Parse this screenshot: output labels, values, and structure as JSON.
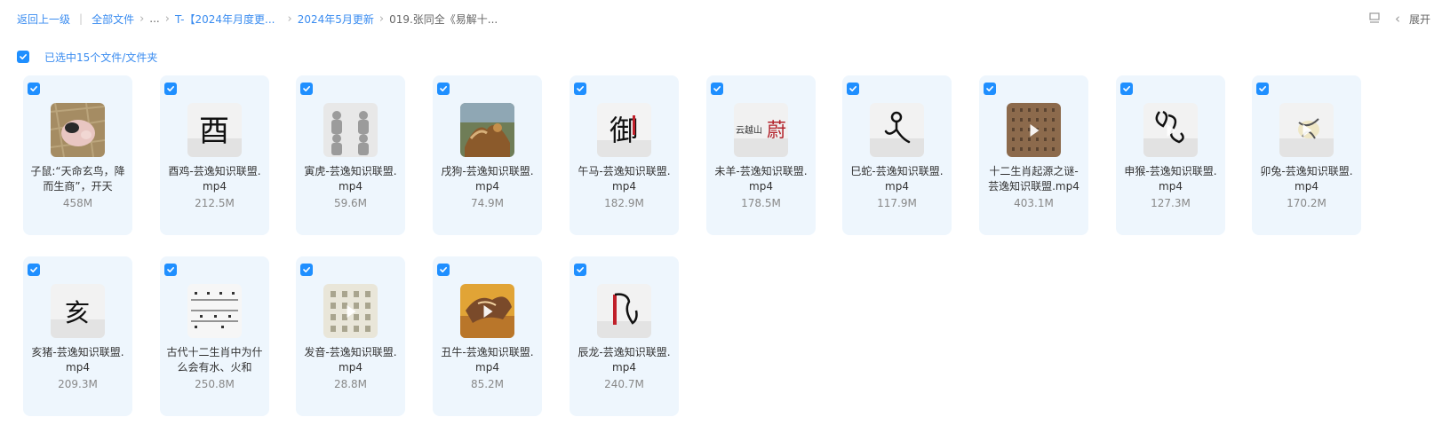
{
  "breadcrumb": {
    "back": "返回上一级",
    "all_files": "全部文件",
    "ellipsis": "...",
    "folder1": "T-【2024年月度更...",
    "folder2": "2024年5月更新",
    "current": "019.张同全《易解十..."
  },
  "top_right": {
    "expand_label": "展开"
  },
  "selection": {
    "label": "已选中15个文件/文件夹"
  },
  "files": [
    {
      "name": "子鼠:“天命玄鸟，降而生商”，开天",
      "size": "458M",
      "thumb": "rat"
    },
    {
      "name": "酉鸡-芸逸知识联盟.mp4",
      "size": "212.5M",
      "thumb": "you"
    },
    {
      "name": "寅虎-芸逸知识联盟.mp4",
      "size": "59.6M",
      "thumb": "tiger"
    },
    {
      "name": "戌狗-芸逸知识联盟.mp4",
      "size": "74.9M",
      "thumb": "dog"
    },
    {
      "name": "午马-芸逸知识联盟.mp4",
      "size": "182.9M",
      "thumb": "yu"
    },
    {
      "name": "未羊-芸逸知识联盟.mp4",
      "size": "178.5M",
      "thumb": "wei"
    },
    {
      "name": "巳蛇-芸逸知识联盟.mp4",
      "size": "117.9M",
      "thumb": "si"
    },
    {
      "name": "十二生肖起源之谜-芸逸知识联盟.mp4",
      "size": "403.1M",
      "thumb": "origin"
    },
    {
      "name": "申猴-芸逸知识联盟.mp4",
      "size": "127.3M",
      "thumb": "shen"
    },
    {
      "name": "卯兔-芸逸知识联盟.mp4",
      "size": "170.2M",
      "thumb": "mao"
    },
    {
      "name": "亥猪-芸逸知识联盟.mp4",
      "size": "209.3M",
      "thumb": "hai"
    },
    {
      "name": "古代十二生肖中为什么会有水、火和",
      "size": "250.8M",
      "thumb": "lines"
    },
    {
      "name": "发音-芸逸知识联盟.mp4",
      "size": "28.8M",
      "thumb": "fayin"
    },
    {
      "name": "丑牛-芸逸知识联盟.mp4",
      "size": "85.2M",
      "thumb": "ox"
    },
    {
      "name": "辰龙-芸逸知识联盟.mp4",
      "size": "240.7M",
      "thumb": "chen"
    }
  ],
  "thumb_glyphs": {
    "you": "酉",
    "yu": "御",
    "wei": "蔚",
    "wei_small": "云越山",
    "hai": "亥"
  },
  "colors": {
    "accent": "#1f8fff",
    "link": "#3a8cf0",
    "card_bg": "#eef6fd"
  }
}
